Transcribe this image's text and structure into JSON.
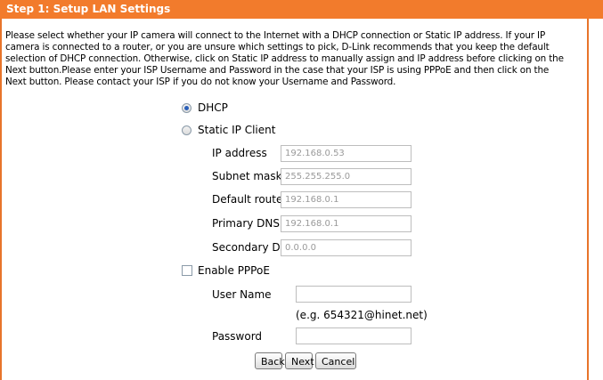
{
  "header": {
    "title": "Step 1: Setup LAN Settings"
  },
  "intro": {
    "line1": "Please select whether your IP camera will connect to the Internet with a DHCP connection or Static IP address. If your IP",
    "line2": "camera is connected to a router, or you are unsure which settings to pick, D-Link recommends that you keep the default",
    "line3": "selection of DHCP connection. Otherwise, click on Static IP address to manually assign and IP address before clicking on the",
    "line4": "Next button.Please enter your ISP Username and Password in the case that your ISP is using PPPoE and then click on the",
    "line5": "Next button. Please contact your ISP if you do not know your Username and Password."
  },
  "mode": {
    "dhcp_label": "DHCP",
    "static_label": "Static IP Client",
    "selected": "DHCP"
  },
  "static": {
    "ip_label": "IP address",
    "ip_value": "192.168.0.53",
    "subnet_label": "Subnet mask",
    "subnet_value": "255.255.255.0",
    "router_label": "Default router",
    "router_value": "192.168.0.1",
    "dns1_label": "Primary DNS",
    "dns1_value": "192.168.0.1",
    "dns2_label": "Secondary DNS",
    "dns2_value": "0.0.0.0"
  },
  "pppoe": {
    "enable_label": "Enable PPPoE",
    "enabled": false,
    "username_label": "User Name",
    "username_value": "",
    "username_hint": "(e.g. 654321@hinet.net)",
    "password_label": "Password",
    "password_value": ""
  },
  "buttons": {
    "back": "Back",
    "next": "Next",
    "cancel": "Cancel"
  },
  "colors": {
    "header_bg": "#f27b2c",
    "border": "#e8742a",
    "radio_dot": "#2a5fb8"
  }
}
